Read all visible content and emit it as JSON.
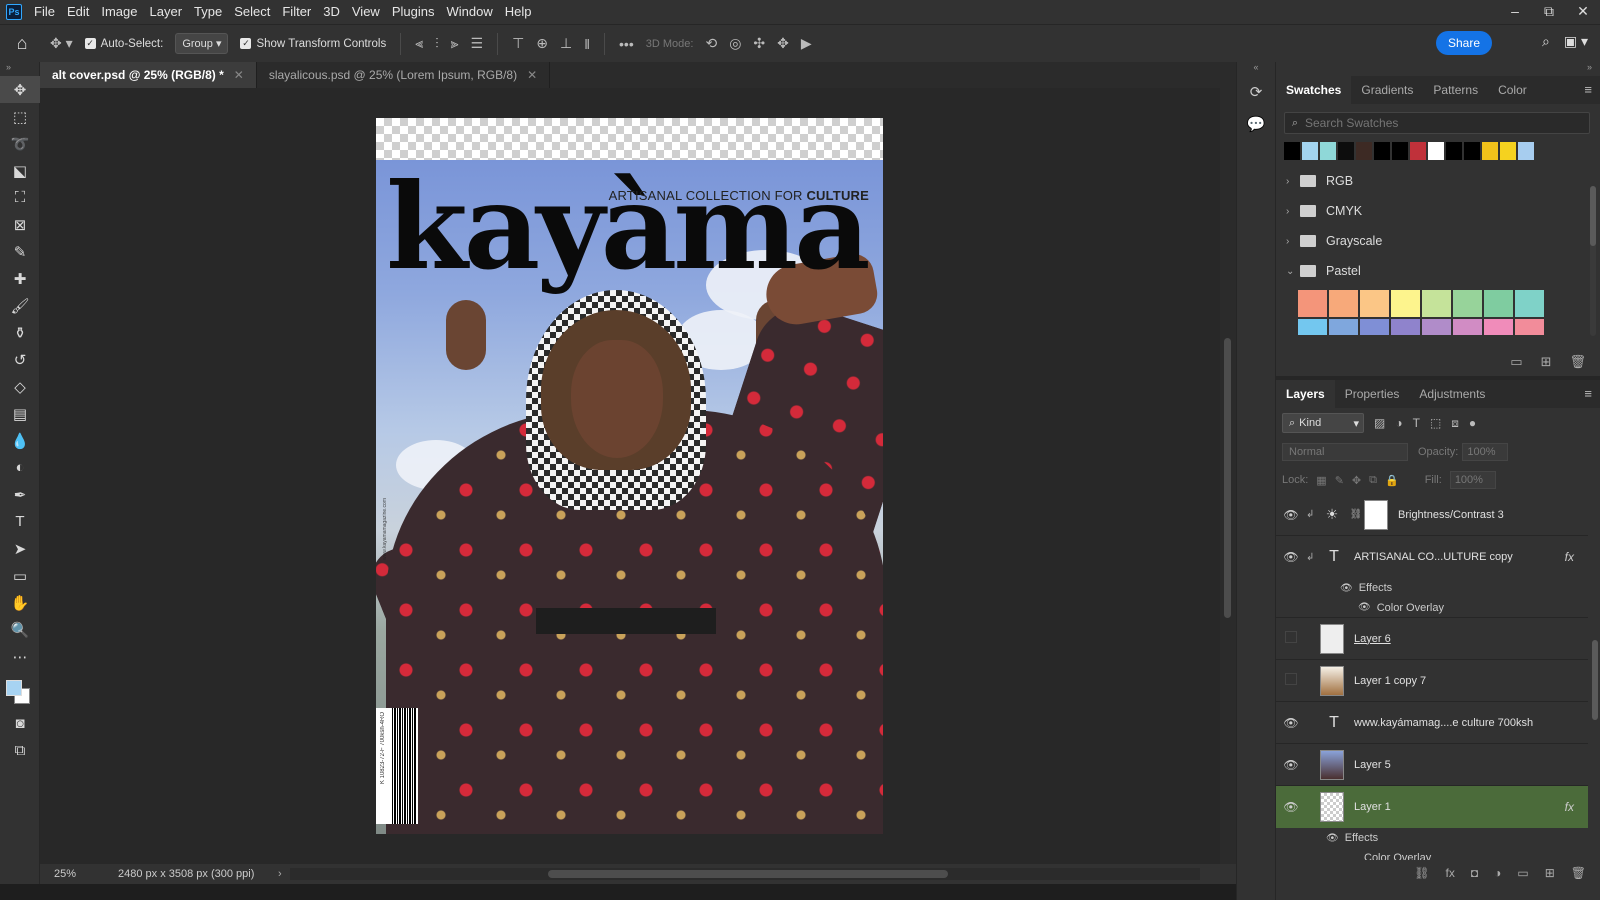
{
  "app": {
    "logo": "Ps"
  },
  "menu": [
    "File",
    "Edit",
    "Image",
    "Layer",
    "Type",
    "Select",
    "Filter",
    "3D",
    "View",
    "Plugins",
    "Window",
    "Help"
  ],
  "window_controls": {
    "minimize": "–",
    "restore": "⧉",
    "close": "✕"
  },
  "options_bar": {
    "auto_select_label": "Auto-Select:",
    "auto_select_target": "Group",
    "show_transform_label": "Show Transform Controls",
    "three_d_mode_label": "3D Mode:",
    "share_label": "Share",
    "more": "•••"
  },
  "tabs": [
    {
      "label": "alt cover.psd @ 25% (RGB/8) *",
      "active": true
    },
    {
      "label": "slayalicous.psd @ 25% (Lorem Ipsum, RGB/8)",
      "active": false
    }
  ],
  "document": {
    "masthead": "kayàma",
    "tagline_prefix": "ARTISANAL COLLECTION FOR ",
    "tagline_bold": "CULTURE",
    "barcode_text": "K 10823-72-F 700ksh-4RO",
    "side_url": "www.kayamamagazine.com"
  },
  "status_bar": {
    "zoom": "25%",
    "doc_info": "2480 px x 3508 px (300 ppi)"
  },
  "swatches_panel": {
    "tabs": [
      "Swatches",
      "Gradients",
      "Patterns",
      "Color"
    ],
    "search_placeholder": "Search Swatches",
    "recent_colors": [
      "#000000",
      "#a3d4ef",
      "#8fd8d8",
      "#0d0d0d",
      "#3d2a24",
      "#000000",
      "#000000",
      "#c0313a",
      "#ffffff",
      "#000000",
      "#000000",
      "#f2c21a",
      "#f5d21f",
      "#a7cdef"
    ],
    "groups": [
      {
        "label": "RGB",
        "expanded": false
      },
      {
        "label": "CMYK",
        "expanded": false
      },
      {
        "label": "Grayscale",
        "expanded": false
      },
      {
        "label": "Pastel",
        "expanded": true
      }
    ],
    "pastel_row1": [
      "#f4957a",
      "#f7a97a",
      "#fbc686",
      "#fdf48d",
      "#c5e39a",
      "#97d39a",
      "#7fcca0",
      "#7fd2c8"
    ],
    "pastel_row2": [
      "#73c7ef",
      "#7fa7dd",
      "#7f8fd6",
      "#8f83cc",
      "#b08cc9",
      "#d18cc4",
      "#f08cba",
      "#f28c9a"
    ]
  },
  "layers_panel": {
    "tabs": [
      "Layers",
      "Properties",
      "Adjustments"
    ],
    "filter_kind": "Kind",
    "blend_mode": "Normal",
    "opacity_label": "Opacity:",
    "opacity_value": "100%",
    "lock_label": "Lock:",
    "fill_label": "Fill:",
    "fill_value": "100%",
    "layers": [
      {
        "name": "Brightness/Contrast 3",
        "visible": true,
        "kind": "adjustment"
      },
      {
        "name": "ARTISANAL CO...ULTURE copy",
        "visible": true,
        "kind": "text",
        "fx": "fx",
        "effects_label": "Effects",
        "effect": "Color Overlay"
      },
      {
        "name": "Layer 6",
        "visible": false,
        "kind": "pixel"
      },
      {
        "name": "Layer 1 copy 7",
        "visible": false,
        "kind": "pixel"
      },
      {
        "name": "www.kayámamag....e culture 700ksh",
        "visible": true,
        "kind": "text"
      },
      {
        "name": "Layer 5",
        "visible": true,
        "kind": "pixel"
      },
      {
        "name": "Layer 1",
        "visible": true,
        "kind": "pixel",
        "selected": true,
        "fx": "fx",
        "effects_label": "Effects",
        "effect": "Color Overlay"
      }
    ]
  }
}
